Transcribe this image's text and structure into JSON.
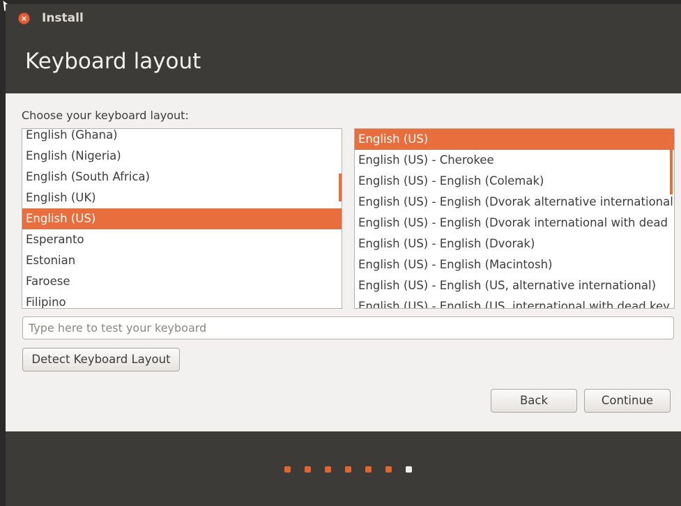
{
  "window": {
    "title": "Install",
    "close_glyph": "×"
  },
  "page": {
    "title": "Keyboard layout",
    "prompt": "Choose your keyboard layout:"
  },
  "layouts": {
    "items": [
      {
        "label": "English (Ghana)",
        "selected": false
      },
      {
        "label": "English (Nigeria)",
        "selected": false
      },
      {
        "label": "English (South Africa)",
        "selected": false
      },
      {
        "label": "English (UK)",
        "selected": false
      },
      {
        "label": "English (US)",
        "selected": true
      },
      {
        "label": "Esperanto",
        "selected": false
      },
      {
        "label": "Estonian",
        "selected": false
      },
      {
        "label": "Faroese",
        "selected": false
      },
      {
        "label": "Filipino",
        "selected": false
      }
    ]
  },
  "variants": {
    "items": [
      {
        "label": "English (US)",
        "selected": true
      },
      {
        "label": "English (US) - Cherokee",
        "selected": false
      },
      {
        "label": "English (US) - English (Colemak)",
        "selected": false
      },
      {
        "label": "English (US) - English (Dvorak alternative international",
        "selected": false
      },
      {
        "label": "English (US) - English (Dvorak international with dead",
        "selected": false
      },
      {
        "label": "English (US) - English (Dvorak)",
        "selected": false
      },
      {
        "label": "English (US) - English (Macintosh)",
        "selected": false
      },
      {
        "label": "English (US) - English (US, alternative international)",
        "selected": false
      },
      {
        "label": "English (US) - English (US, international with dead key",
        "selected": false
      }
    ]
  },
  "test_input": {
    "placeholder": "Type here to test your keyboard",
    "value": ""
  },
  "buttons": {
    "detect": "Detect Keyboard Layout",
    "back": "Back",
    "continue": "Continue"
  },
  "progress": {
    "total_steps": 7,
    "current_step": 7
  },
  "colors": {
    "accent": "#e86f3d",
    "chrome": "#3c3b37",
    "content_bg": "#f2f1f0"
  }
}
